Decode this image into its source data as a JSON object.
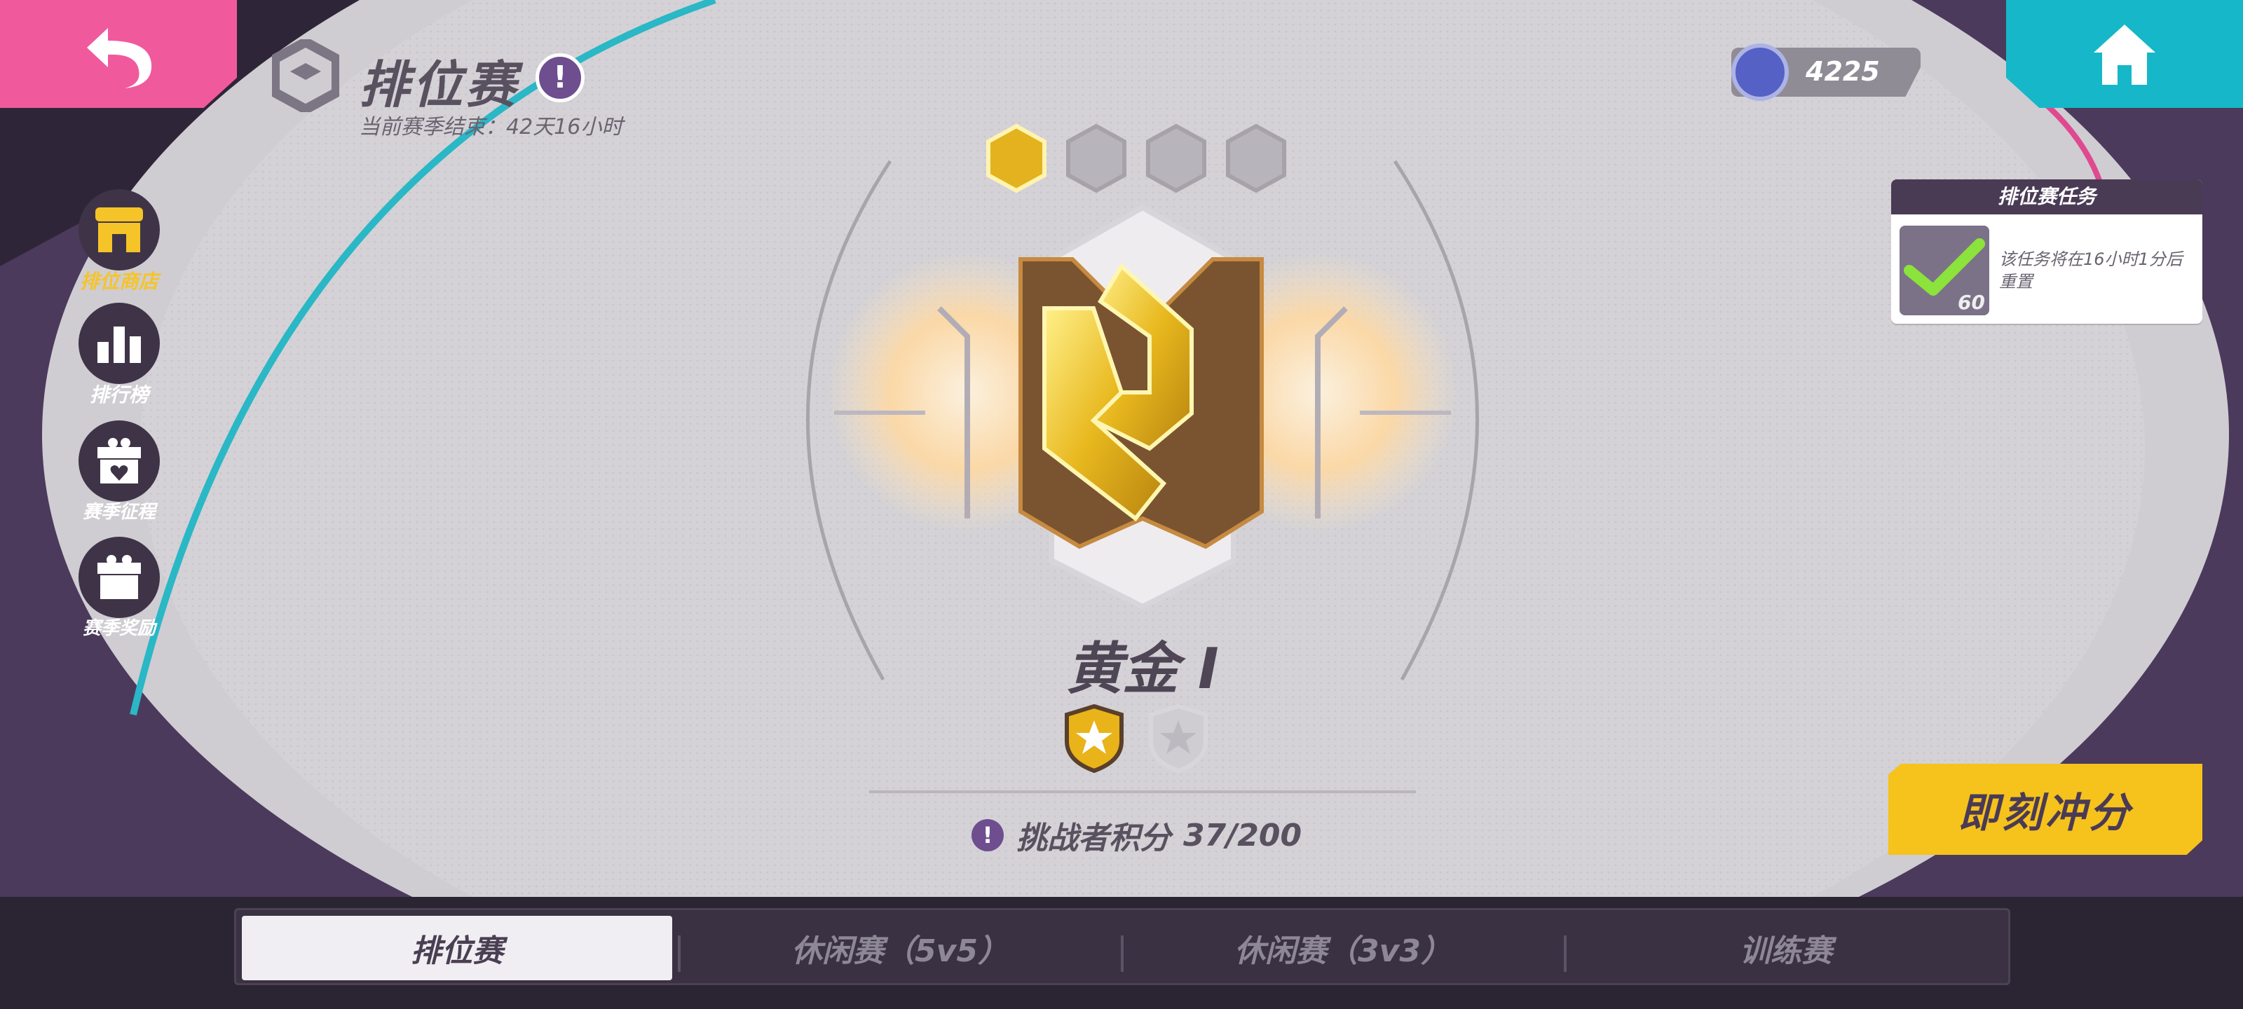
{
  "header": {
    "back_icon": "back-arrow-icon",
    "home_icon": "home-icon",
    "title": "排位赛",
    "title_info_icon": "!",
    "season_end": "当前赛季结束：42天16小时",
    "currency_icon": "rank-coin-icon",
    "currency_value": "4225"
  },
  "sidebar": {
    "items": [
      {
        "label": "排位商店",
        "icon": "shop-icon",
        "active": true
      },
      {
        "label": "排行榜",
        "icon": "leaderboard-icon",
        "active": false
      },
      {
        "label": "赛季征程",
        "icon": "season-journey-icon",
        "active": false
      },
      {
        "label": "赛季奖励",
        "icon": "season-reward-icon",
        "active": false
      }
    ]
  },
  "rank": {
    "tier_progress": {
      "filled": 1,
      "total": 4
    },
    "name": "黄金 I",
    "stars": {
      "earned": 1,
      "total": 2
    },
    "challenger_label": "挑战者积分",
    "challenger_value": "37/200",
    "info_icon": "!"
  },
  "task_panel": {
    "title": "排位赛任务",
    "thumb_number": "60",
    "text": "该任务将在16小时1分后重置"
  },
  "action_button": {
    "label": "即刻冲分"
  },
  "tabs": [
    {
      "label": "排位赛",
      "active": true
    },
    {
      "label": "休闲赛（5v5）",
      "active": false
    },
    {
      "label": "休闲赛（3v3）",
      "active": false
    },
    {
      "label": "训练赛",
      "active": false
    }
  ],
  "colors": {
    "back": "#f05a9d",
    "home": "#16b7c8",
    "accent_gold": "#f6c21c",
    "purple": "#4a3b55"
  }
}
